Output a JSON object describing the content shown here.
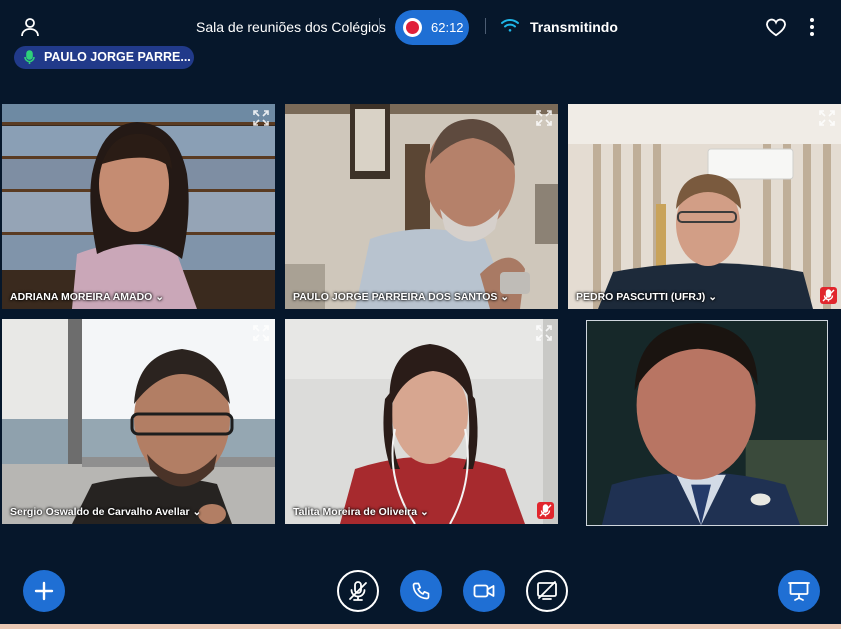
{
  "header": {
    "room_title": "Sala de reuniões dos Colégios",
    "recording_time": "62:12",
    "stream_status": "Transmitindo",
    "icons": [
      "user-icon",
      "record-icon",
      "wifi-icon",
      "heart-icon",
      "more-vertical-icon"
    ]
  },
  "speaking_indicator": {
    "name": "PAULO JORGE PARRE..."
  },
  "participants": [
    {
      "name": "ADRIANA MOREIRA AMADO",
      "muted": false
    },
    {
      "name": "PAULO JORGE PARREIRA DOS SANTOS",
      "muted": false
    },
    {
      "name": "PEDRO PASCUTTI (UFRJ)",
      "muted": true
    },
    {
      "name": "Sergio Oswaldo de Carvalho Avellar",
      "muted": false
    },
    {
      "name": "Talita Moreira de Oliveira",
      "muted": true
    },
    {
      "name": "",
      "muted": false
    }
  ],
  "toolbar": {
    "icons": [
      "plus-icon",
      "mic-off-icon",
      "phone-icon",
      "video-icon",
      "screen-share-off-icon",
      "presentation-icon"
    ]
  },
  "colors": {
    "background": "#06172b",
    "accent": "#1f6fd4",
    "muted_badge": "#e1262d",
    "speaking_pill": "#213a8a"
  }
}
